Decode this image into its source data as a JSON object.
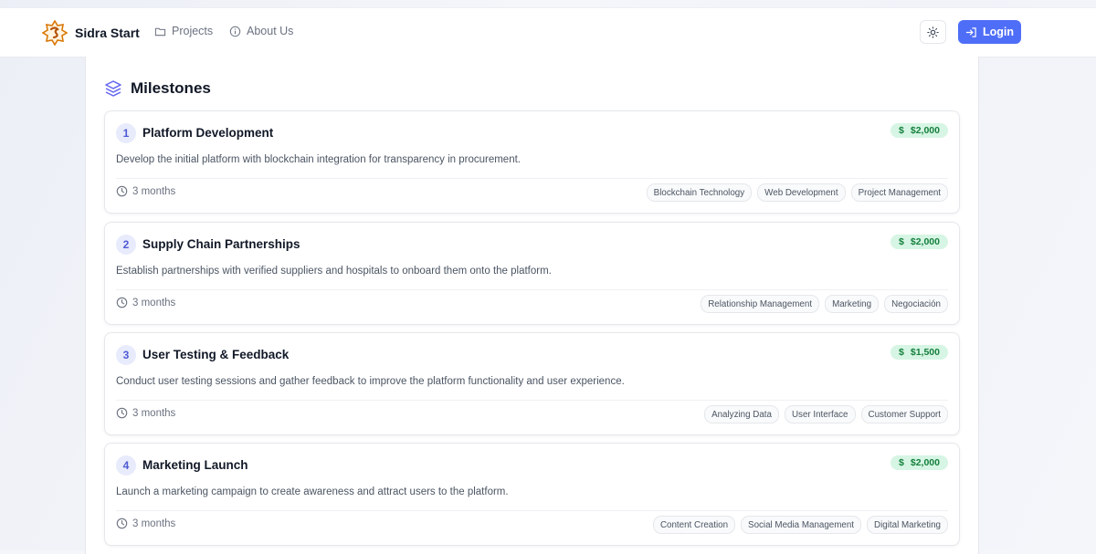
{
  "header": {
    "brand": "Sidra Start",
    "nav": [
      {
        "label": "Projects",
        "icon": "folder-icon"
      },
      {
        "label": "About Us",
        "icon": "info-icon"
      }
    ],
    "theme_icon": "sun-icon",
    "login_label": "Login"
  },
  "section": {
    "title": "Milestones",
    "icon": "layers-icon"
  },
  "colors": {
    "accent": "#4f6ef7",
    "price_bg": "#d7f5e4",
    "price_text": "#15803d"
  },
  "milestones": [
    {
      "number": "1",
      "title": "Platform Development",
      "price": "$2,000",
      "description": "Develop the initial platform with blockchain integration for transparency in procurement.",
      "duration": "3 months",
      "tags": [
        "Blockchain Technology",
        "Web Development",
        "Project Management"
      ]
    },
    {
      "number": "2",
      "title": "Supply Chain Partnerships",
      "price": "$2,000",
      "description": "Establish partnerships with verified suppliers and hospitals to onboard them onto the platform.",
      "duration": "3 months",
      "tags": [
        "Relationship Management",
        "Marketing",
        "Negociación"
      ]
    },
    {
      "number": "3",
      "title": "User Testing & Feedback",
      "price": "$1,500",
      "description": "Conduct user testing sessions and gather feedback to improve the platform functionality and user experience.",
      "duration": "3 months",
      "tags": [
        "Analyzing Data",
        "User Interface",
        "Customer Support"
      ]
    },
    {
      "number": "4",
      "title": "Marketing Launch",
      "price": "$2,000",
      "description": "Launch a marketing campaign to create awareness and attract users to the platform.",
      "duration": "3 months",
      "tags": [
        "Content Creation",
        "Social Media Management",
        "Digital Marketing"
      ]
    }
  ]
}
